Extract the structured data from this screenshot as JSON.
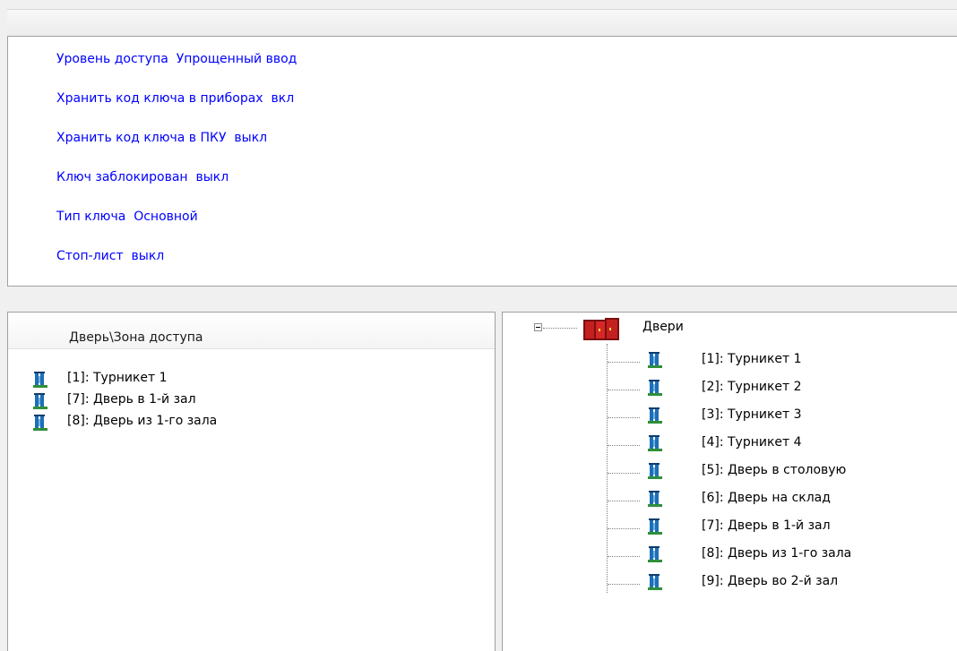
{
  "properties": [
    {
      "name": "Уровень доступа",
      "value": "Упрощенный ввод"
    },
    {
      "name": "Хранить код ключа в приборах",
      "value": "вкл"
    },
    {
      "name": "Хранить код ключа в ПКУ",
      "value": "выкл"
    },
    {
      "name": "Ключ заблокирован",
      "value": "выкл"
    },
    {
      "name": "Тип ключа",
      "value": "Основной"
    },
    {
      "name": "Стоп-лист",
      "value": "выкл"
    }
  ],
  "assigned_doors": {
    "column_header": "Дверь\\Зона доступа",
    "items": [
      {
        "label": "[1]: Турникет 1",
        "icon": "door-icon"
      },
      {
        "label": "[7]: Дверь в 1-й зал",
        "icon": "door-icon"
      },
      {
        "label": "[8]: Дверь из 1-го зала",
        "icon": "door-icon"
      }
    ]
  },
  "doors_tree": {
    "root": {
      "label": "Двери",
      "icon": "doors-group-icon",
      "expanded": true
    },
    "items": [
      {
        "label": "[1]: Турникет 1",
        "icon": "door-icon"
      },
      {
        "label": "[2]: Турникет 2",
        "icon": "door-icon"
      },
      {
        "label": "[3]: Турникет 3",
        "icon": "door-icon"
      },
      {
        "label": "[4]: Турникет 4",
        "icon": "door-icon"
      },
      {
        "label": "[5]: Дверь в столовую",
        "icon": "door-icon"
      },
      {
        "label": "[6]: Дверь на склад",
        "icon": "door-icon"
      },
      {
        "label": "[7]: Дверь в 1-й зал",
        "icon": "door-icon"
      },
      {
        "label": "[8]: Дверь из 1-го зала",
        "icon": "door-icon"
      },
      {
        "label": "[9]: Дверь во 2-й зал",
        "icon": "door-icon"
      }
    ]
  },
  "colors": {
    "link": "#0000ff",
    "panel_border": "#a0a0a0",
    "door_icon_body": "#1f6fb5",
    "door_icon_base": "#2f8f3a",
    "group_icon": "#b01c1c"
  }
}
